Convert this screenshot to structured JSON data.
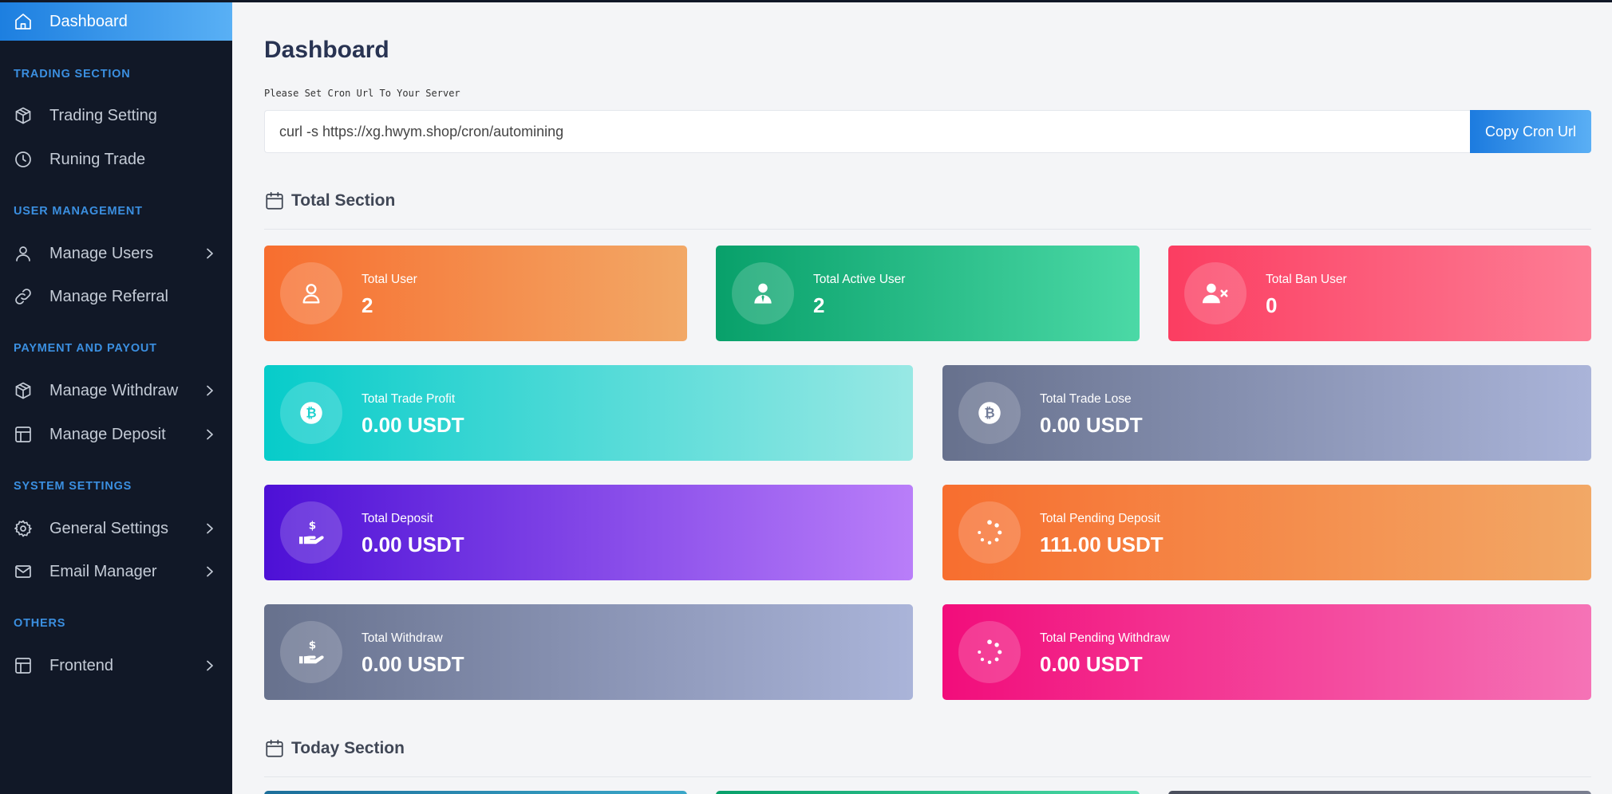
{
  "sidebar": {
    "active": {
      "label": "Dashboard",
      "icon": "home-icon"
    },
    "sections": [
      {
        "label": "TRADING SECTION"
      },
      {
        "label": "USER MANAGEMENT"
      },
      {
        "label": "PAYMENT AND PAYOUT"
      },
      {
        "label": "SYSTEM SETTINGS"
      },
      {
        "label": "OTHERS"
      }
    ],
    "items": [
      {
        "label": "Trading Setting",
        "icon": "cube-icon"
      },
      {
        "label": "Runing Trade",
        "icon": "clock-icon"
      },
      {
        "label": "Manage Users",
        "icon": "user-icon"
      },
      {
        "label": "Manage Referral",
        "icon": "link-icon"
      },
      {
        "label": "Manage Withdraw",
        "icon": "cube-icon"
      },
      {
        "label": "Manage Deposit",
        "icon": "layout-icon"
      },
      {
        "label": "General Settings",
        "icon": "gear-icon"
      },
      {
        "label": "Email Manager",
        "icon": "mail-icon"
      },
      {
        "label": "Frontend",
        "icon": "layout-icon"
      }
    ]
  },
  "main": {
    "title": "Dashboard",
    "cron": {
      "label": "Please Set Cron Url To Your Server",
      "value": "curl -s https://xg.hwym.shop/cron/automining",
      "button": "Copy Cron Url"
    },
    "total_section": {
      "title": "Total Section",
      "cards": [
        {
          "title": "Total User",
          "value": "2",
          "icon": "user-icon"
        },
        {
          "title": "Total Active User",
          "value": "2",
          "icon": "user-tie-icon"
        },
        {
          "title": "Total Ban User",
          "value": "0",
          "icon": "user-x-icon"
        },
        {
          "title": "Total Trade Profit",
          "value": "0.00 USDT",
          "icon": "bitcoin-icon"
        },
        {
          "title": "Total Trade Lose",
          "value": "0.00 USDT",
          "icon": "bitcoin-icon"
        },
        {
          "title": "Total Deposit",
          "value": "0.00 USDT",
          "icon": "hand-dollar-icon"
        },
        {
          "title": "Total Pending Deposit",
          "value": "111.00 USDT",
          "icon": "spinner-icon"
        },
        {
          "title": "Total Withdraw",
          "value": "0.00 USDT",
          "icon": "hand-dollar-icon"
        },
        {
          "title": "Total Pending Withdraw",
          "value": "0.00 USDT",
          "icon": "spinner-icon"
        }
      ]
    },
    "today_section": {
      "title": "Today Section"
    }
  }
}
